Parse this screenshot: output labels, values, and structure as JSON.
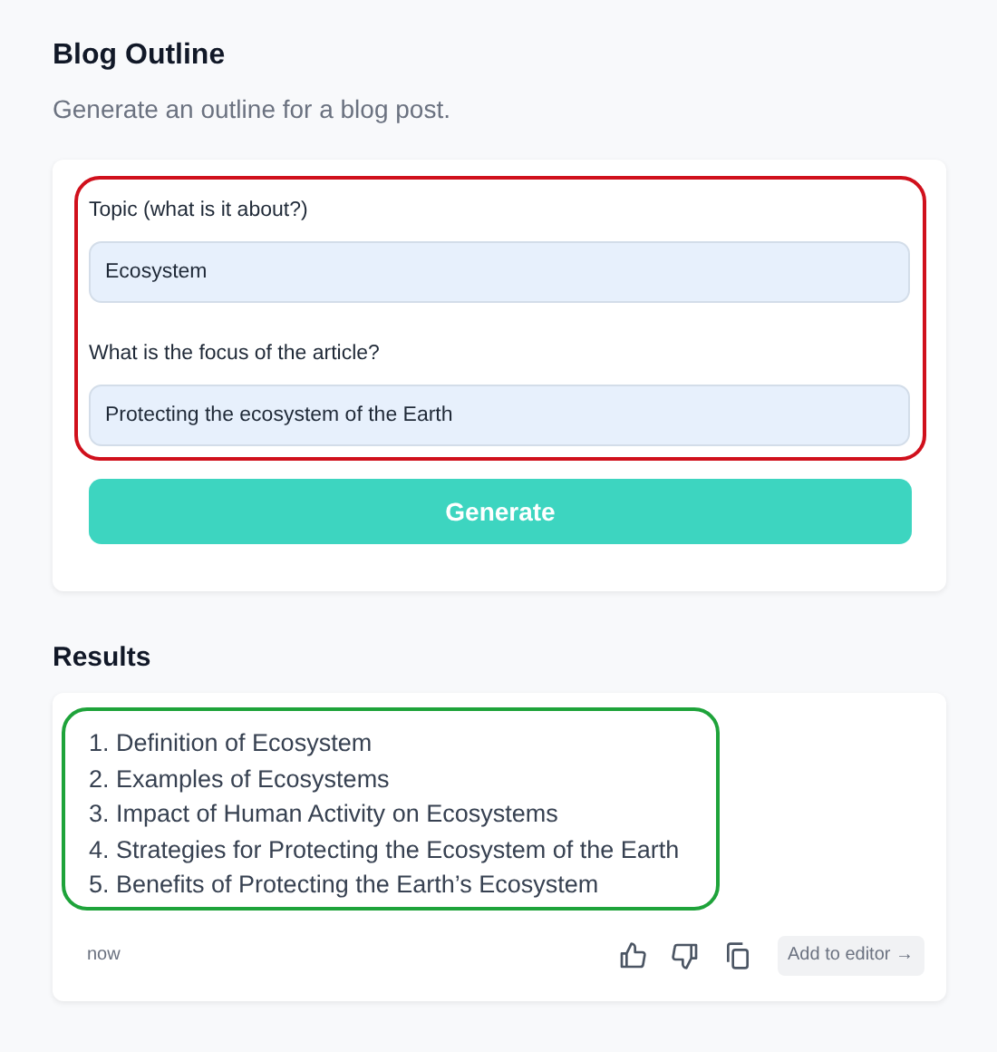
{
  "header": {
    "title": "Blog Outline",
    "subtitle": "Generate an outline for a blog post."
  },
  "form": {
    "fields": [
      {
        "label": "Topic (what is it about?)",
        "value": "Ecosystem"
      },
      {
        "label": "What is the focus of the article?",
        "value": "Protecting the ecosystem of the Earth"
      }
    ],
    "generate_button": "Generate"
  },
  "results": {
    "title": "Results",
    "lines": [
      "1. Definition of Ecosystem",
      "2. Examples of Ecosystems",
      "3. Impact of Human Activity on Ecosystems",
      "4. Strategies for Protecting the Ecosystem of the Earth",
      "5. Benefits of Protecting the Earth’s Ecosystem"
    ],
    "timestamp": "now",
    "add_to_editor_button": "Add to editor →"
  }
}
